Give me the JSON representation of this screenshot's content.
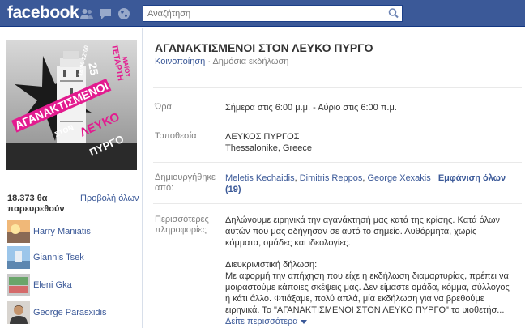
{
  "topbar": {
    "logo": "facebook",
    "search_placeholder": "Αναζήτηση"
  },
  "event": {
    "title": "ΑΓΑΝΑΚΤΙΣΜΕΝΟΙ ΣΤΟΝ ΛΕΥΚΟ ΠΥΡΓΟ",
    "share_label": "Κοινοποίηση",
    "separator": "·",
    "privacy": "Δημόσια εκδήλωση"
  },
  "poster": {
    "time": "18:00-22:00",
    "day": "ΤΕΤΑΡΤΗ",
    "date": "25",
    "month": "ΜΑΪΟΥ",
    "line1": "ΑΓΑΝΑΚΤΙΣΜΕΝΟΙ",
    "line2": "ΣΤΟΝ",
    "line3": "ΛΕΥΚΟ",
    "line4": "ΠΥΡΓΟ"
  },
  "attendees": {
    "count_label": "18.373 θα παρευρεθούν",
    "view_all": "Προβολή όλων",
    "people": [
      {
        "name": "Harry Maniatis"
      },
      {
        "name": "Giannis Tsek"
      },
      {
        "name": "Eleni Gka"
      },
      {
        "name": "George Parasxidis"
      }
    ]
  },
  "details": {
    "time_label": "Ώρα",
    "time_value": "Σήμερα στις 6:00 μ.μ. - Αύριο στις 6:00 π.μ.",
    "location_label": "Τοποθεσία",
    "location_line1": "ΛΕΥΚΟΣ ΠΥΡΓΟΣ",
    "location_line2": "Thessalonike, Greece",
    "creators_label": "Δημιουργήθηκε από:",
    "creators": [
      "Meletis Kechaidis",
      "Dimitris Reppos",
      "George Xexakis"
    ],
    "creators_sep1": ", ",
    "creators_sep2": ", ",
    "show_all": "Εμφάνιση όλων (19)",
    "more_label": "Περισσότερες πληροφορίες",
    "desc_p1": "Δηλώνουμε ειρηνικά την αγανάκτησή μας κατά της κρίσης. Κατά όλων αυτών που μας οδήγησαν σε αυτό το σημείο. Αυθόρμητα, χωρίς κόμματα, ομάδες και ιδεολογίες.",
    "desc_p2": "Διευκρινιστική δήλωση:\nΜε αφορμή την απήχηση που είχε η εκδήλωση διαμαρτυρίας, πρέπει να μοιραστούμε κάποιες σκέψεις μας. Δεν είμαστε ομάδα, κόμμα, σύλλογος ή κάτι άλλο. Φτιάξαμε, πολύ απλά, μία εκδήλωση για να βρεθούμε ειρηνικά. Το \"ΑΓΑΝΑΚΤΙΣΜΕΝΟΙ ΣΤΟΝ ΛΕΥΚΟ ΠΥΡΓΟ\" το υιοθετήσ...",
    "see_more": "Δείτε περισσότερα"
  },
  "colors": {
    "brand": "#3b5998",
    "link": "#3b5998",
    "label_gray": "#808080"
  }
}
